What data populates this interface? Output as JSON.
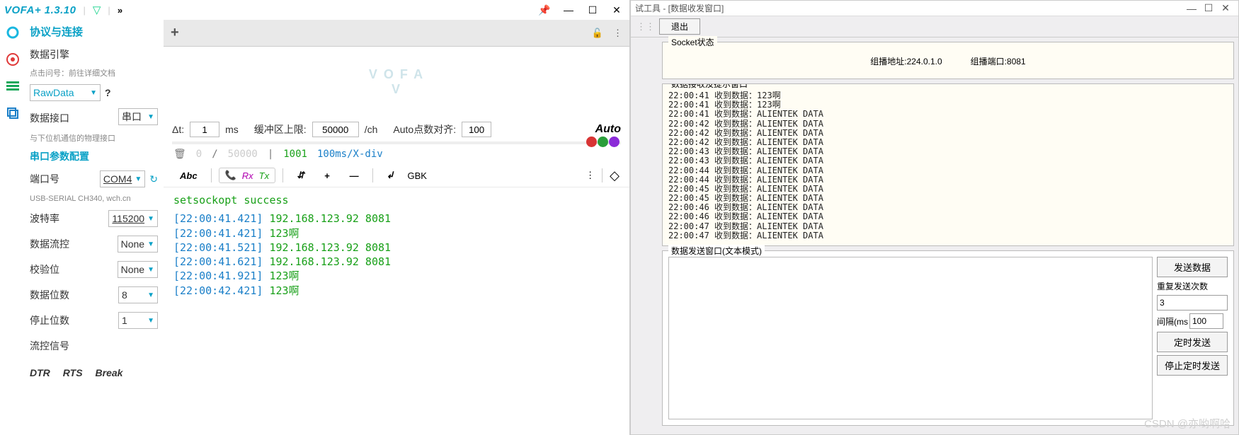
{
  "vofa": {
    "title": "VOFA+ 1.3.10",
    "more_glyph": "»",
    "win": {
      "pin": "📌",
      "min": "—",
      "max": "☐",
      "close": "✕"
    },
    "sidebar": {
      "protocol_title": "协议与连接",
      "engine_label": "数据引擎",
      "engine_hint": "点击问号：前往详细文档",
      "engine_value": "RawData",
      "qmark": "?",
      "iface_label": "数据接口",
      "iface_hint": "与下位机通信的物理接口",
      "iface_value": "串口",
      "serial_title": "串口参数配置",
      "port_label": "端口号",
      "port_value": "COM4",
      "port_hint": "USB-SERIAL CH340, wch.cn",
      "baud_label": "波特率",
      "baud_value": "115200",
      "flow_label": "数据流控",
      "flow_value": "None",
      "parity_label": "校验位",
      "parity_value": "None",
      "databits_label": "数据位数",
      "databits_value": "8",
      "stopbits_label": "停止位数",
      "stopbits_value": "1",
      "signal_label": "流控信号",
      "dtr": "DTR",
      "rts": "RTS",
      "brk": "Break",
      "refresh_glyph": "↻"
    },
    "tabbar": {
      "plus": "+",
      "lock": "🔓",
      "menu": "⋮"
    },
    "logo": "V O F A\nV",
    "controls": {
      "dt_label": "Δt:",
      "dt_value": "1",
      "dt_unit": "ms",
      "buf_label": "缓冲区上限:",
      "buf_value": "50000",
      "buf_unit": "/ch",
      "auto_label": "Auto点数对齐:",
      "auto_value": "100",
      "auto_word": "Auto"
    },
    "status": {
      "trash": "🗑",
      "zero": "0",
      "slash": "/",
      "max": "50000",
      "bar": "|",
      "cnt": "1001",
      "rate": "100ms/X-div"
    },
    "toolbar": {
      "abc": "Abc",
      "rx": "Rx",
      "tx": "Tx",
      "phone": "📞",
      "line": "⇵",
      "plus": "+",
      "minus": "—",
      "wrap": "↲",
      "enc": "GBK",
      "menu": "⋮",
      "eraser": "◇"
    },
    "terminal": {
      "header": "setsockopt success",
      "lines": [
        {
          "ts": "[22:00:41.421]",
          "pl": "192.168.123.92 8081"
        },
        {
          "ts": "[22:00:41.421]",
          "pl": "123啊"
        },
        {
          "ts": "[22:00:41.521]",
          "pl": "192.168.123.92 8081"
        },
        {
          "ts": "[22:00:41.621]",
          "pl": "192.168.123.92 8081"
        },
        {
          "ts": "[22:00:41.921]",
          "pl": "123啊"
        },
        {
          "ts": "[22:00:42.421]",
          "pl": "123啊"
        }
      ]
    }
  },
  "sock": {
    "title_suffix": "试工具 - [数据收发窗口]",
    "exit_btn": "退出",
    "status_legend": "Socket状态",
    "addr_label": "组播地址:",
    "addr_value": "224.0.1.0",
    "port_label": "组播端口:",
    "port_value": "8081",
    "recv_legend": "数据接收及提示窗口",
    "recv_lines": [
      "22:00:41 收到数据：123啊",
      "22:00:41 收到数据：123啊",
      "22:00:41 收到数据：ALIENTEK DATA",
      "22:00:42 收到数据：ALIENTEK DATA",
      "22:00:42 收到数据：ALIENTEK DATA",
      "22:00:42 收到数据：ALIENTEK DATA",
      "22:00:43 收到数据：ALIENTEK DATA",
      "22:00:43 收到数据：ALIENTEK DATA",
      "22:00:44 收到数据：ALIENTEK DATA",
      "22:00:44 收到数据：ALIENTEK DATA",
      "22:00:45 收到数据：ALIENTEK DATA",
      "22:00:45 收到数据：ALIENTEK DATA",
      "22:00:46 收到数据：ALIENTEK DATA",
      "22:00:46 收到数据：ALIENTEK DATA",
      "22:00:47 收到数据：ALIENTEK DATA",
      "22:00:47 收到数据：ALIENTEK DATA"
    ],
    "send_legend": "数据发送窗口(文本模式)",
    "send_btn": "发送数据",
    "repeat_label": "重复发送次数",
    "repeat_value": "3",
    "interval_label": "间隔(ms",
    "interval_value": "100",
    "timer_start": "定时发送",
    "timer_stop": "停止定时发送",
    "watermark": "CSDN @亦哟啊哈"
  }
}
